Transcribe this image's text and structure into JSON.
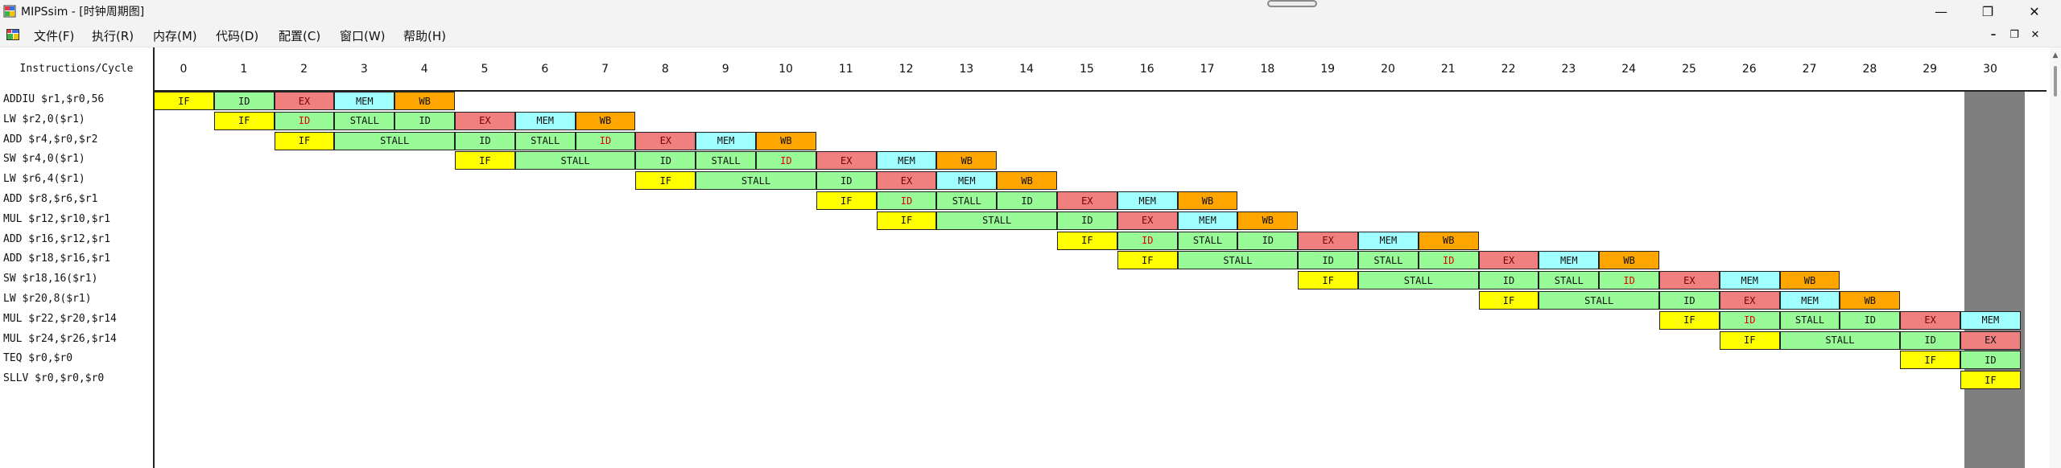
{
  "window": {
    "title": "MIPSsim - [时钟周期图]",
    "minimize_glyph": "—",
    "maximize_glyph": "❐",
    "close_glyph": "✕"
  },
  "menu": {
    "items": [
      "文件(F)",
      "执行(R)",
      "内存(M)",
      "代码(D)",
      "配置(C)",
      "窗口(W)",
      "帮助(H)"
    ],
    "mdi_minimize": "–",
    "mdi_restore": "❐",
    "mdi_close": "✕"
  },
  "grid": {
    "header_label": "Instructions/Cycle",
    "cycles": [
      "0",
      "1",
      "2",
      "3",
      "4",
      "5",
      "6",
      "7",
      "8",
      "9",
      "10",
      "11",
      "12",
      "13",
      "14",
      "15",
      "16",
      "17",
      "18",
      "19",
      "20",
      "21",
      "22",
      "23",
      "24",
      "25",
      "26",
      "27",
      "28",
      "29",
      "30"
    ],
    "current_cycle": 30,
    "instructions": [
      "ADDIU $r1,$r0,56",
      "LW $r2,0($r1)",
      "ADD $r4,$r0,$r2",
      "SW $r4,0($r1)",
      "LW $r6,4($r1)",
      "ADD $r8,$r6,$r1",
      "MUL $r12,$r10,$r1",
      "ADD $r16,$r12,$r1",
      "ADD $r18,$r16,$r1",
      "SW $r18,16($r1)",
      "LW $r20,8($r1)",
      "MUL $r22,$r20,$r14",
      "MUL $r24,$r26,$r14",
      "TEQ $r0,$r0",
      "SLLV $r0,$r0,$r0"
    ],
    "rows": [
      [
        [
          "IF",
          0,
          1
        ],
        [
          "ID",
          1,
          1
        ],
        [
          "EX",
          2,
          1
        ],
        [
          "MEM",
          3,
          1
        ],
        [
          "WB",
          4,
          1
        ]
      ],
      [
        [
          "IF",
          1,
          1
        ],
        [
          "ID",
          2,
          1
        ],
        [
          "STALL",
          3,
          1
        ],
        [
          "ID",
          4,
          1
        ],
        [
          "EX",
          5,
          1
        ],
        [
          "MEM",
          6,
          1
        ],
        [
          "WB",
          7,
          1
        ]
      ],
      [
        [
          "IF",
          2,
          1
        ],
        [
          "STALL",
          3,
          2
        ],
        [
          "ID",
          5,
          1
        ],
        [
          "STALL",
          6,
          1
        ],
        [
          "ID",
          7,
          1
        ],
        [
          "EX",
          8,
          1
        ],
        [
          "MEM",
          9,
          1
        ],
        [
          "WB",
          10,
          1
        ]
      ],
      [
        [
          "IF",
          5,
          1
        ],
        [
          "STALL",
          6,
          2
        ],
        [
          "ID",
          8,
          1
        ],
        [
          "STALL",
          9,
          1
        ],
        [
          "ID",
          10,
          1
        ],
        [
          "EX",
          11,
          1
        ],
        [
          "MEM",
          12,
          1
        ],
        [
          "WB",
          13,
          1
        ]
      ],
      [
        [
          "IF",
          8,
          1
        ],
        [
          "STALL",
          9,
          2
        ],
        [
          "ID",
          11,
          1
        ],
        [
          "EX",
          12,
          1
        ],
        [
          "MEM",
          13,
          1
        ],
        [
          "WB",
          14,
          1
        ]
      ],
      [
        [
          "IF",
          11,
          1
        ],
        [
          "ID",
          12,
          1
        ],
        [
          "STALL",
          13,
          1
        ],
        [
          "ID",
          14,
          1
        ],
        [
          "EX",
          15,
          1
        ],
        [
          "MEM",
          16,
          1
        ],
        [
          "WB",
          17,
          1
        ]
      ],
      [
        [
          "IF",
          12,
          1
        ],
        [
          "STALL",
          13,
          2
        ],
        [
          "ID",
          15,
          1
        ],
        [
          "EX",
          16,
          1
        ],
        [
          "MEM",
          17,
          1
        ],
        [
          "WB",
          18,
          1
        ]
      ],
      [
        [
          "IF",
          15,
          1
        ],
        [
          "ID",
          16,
          1
        ],
        [
          "STALL",
          17,
          1
        ],
        [
          "ID",
          18,
          1
        ],
        [
          "EX",
          19,
          1
        ],
        [
          "MEM",
          20,
          1
        ],
        [
          "WB",
          21,
          1
        ]
      ],
      [
        [
          "IF",
          16,
          1
        ],
        [
          "STALL",
          17,
          2
        ],
        [
          "ID",
          19,
          1
        ],
        [
          "STALL",
          20,
          1
        ],
        [
          "ID",
          21,
          1
        ],
        [
          "EX",
          22,
          1
        ],
        [
          "MEM",
          23,
          1
        ],
        [
          "WB",
          24,
          1
        ]
      ],
      [
        [
          "IF",
          19,
          1
        ],
        [
          "STALL",
          20,
          2
        ],
        [
          "ID",
          22,
          1
        ],
        [
          "STALL",
          23,
          1
        ],
        [
          "ID",
          24,
          1
        ],
        [
          "EX",
          25,
          1
        ],
        [
          "MEM",
          26,
          1
        ],
        [
          "WB",
          27,
          1
        ]
      ],
      [
        [
          "IF",
          22,
          1
        ],
        [
          "STALL",
          23,
          2
        ],
        [
          "ID",
          25,
          1
        ],
        [
          "EX",
          26,
          1
        ],
        [
          "MEM",
          27,
          1
        ],
        [
          "WB",
          28,
          1
        ]
      ],
      [
        [
          "IF",
          25,
          1
        ],
        [
          "ID",
          26,
          1
        ],
        [
          "STALL",
          27,
          1
        ],
        [
          "ID",
          28,
          1
        ],
        [
          "EX",
          29,
          1
        ],
        [
          "MEM",
          30,
          1
        ]
      ],
      [
        [
          "IF",
          26,
          1
        ],
        [
          "STALL",
          27,
          2
        ],
        [
          "ID",
          29,
          1
        ],
        [
          "EX",
          30,
          1
        ]
      ],
      [
        [
          "IF",
          29,
          1
        ],
        [
          "ID",
          30,
          1
        ]
      ],
      [
        [
          "IF",
          30,
          1
        ]
      ]
    ],
    "red_text_ids": [
      [
        1,
        1
      ],
      [
        2,
        2
      ],
      [
        3,
        2
      ],
      [
        5,
        1
      ],
      [
        7,
        1
      ],
      [
        8,
        2
      ],
      [
        9,
        2
      ],
      [
        11,
        1
      ]
    ]
  },
  "stage_colors": {
    "IF": "#ffff00",
    "ID": "#98fb98",
    "STALL": "#98fb98",
    "EX": "#f08080",
    "MEM": "#a0ffff",
    "WB": "#ffa500"
  },
  "icons": {
    "app": "mipssim-app-icon",
    "menu": "mdi-document-icon"
  }
}
